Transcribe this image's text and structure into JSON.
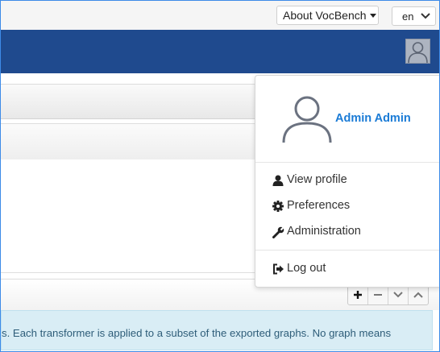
{
  "topbar": {
    "about_label": "About VocBench",
    "language_value": "en"
  },
  "user_menu": {
    "user_name": "Admin Admin",
    "items": [
      {
        "label": "View profile",
        "icon": "user-icon"
      },
      {
        "label": "Preferences",
        "icon": "gear-icon"
      },
      {
        "label": "Administration",
        "icon": "wrench-icon"
      },
      {
        "label": "Log out",
        "icon": "sign-out-icon"
      }
    ]
  },
  "panel": {
    "toolbar_icons": [
      "plus-icon",
      "minus-icon",
      "chevron-down-icon",
      "chevron-up-icon"
    ],
    "info_text": "s. Each transformer is applied to a subset of the exported graphs. No graph means"
  },
  "colors": {
    "navbar": "#1f4a8e",
    "link": "#1a7bd6",
    "info_bg": "#d9edf5"
  }
}
